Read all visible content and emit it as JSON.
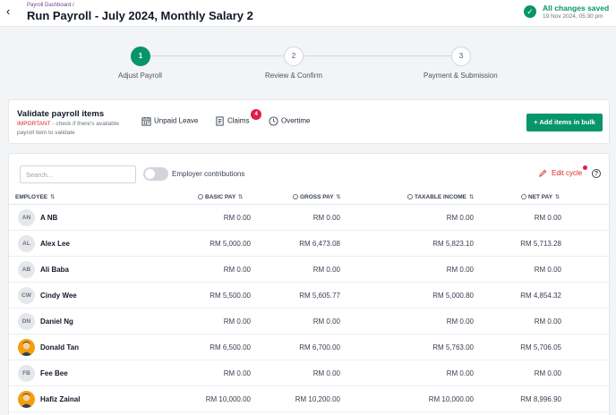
{
  "header": {
    "breadcrumb": "Payroll Dashboard /",
    "title": "Run Payroll - July 2024, Monthly Salary 2",
    "save_status": "All changes saved",
    "save_time": "19 Nov 2024, 05:30 pm",
    "status_color": "#079669"
  },
  "steps": [
    {
      "number": "1",
      "label": "Adjust Payroll",
      "active": true
    },
    {
      "number": "2",
      "label": "Review & Confirm",
      "active": false
    },
    {
      "number": "3",
      "label": "Payment & Submission",
      "active": false
    }
  ],
  "validate": {
    "title": "Validate payroll items",
    "important": "IMPORTANT",
    "subtitle": " - check if there's available payroll item to validate",
    "items": {
      "unpaid_leave": "Unpaid Leave",
      "claims": "Claims",
      "claims_badge": "4",
      "overtime": "Overtime"
    },
    "add_bulk_label": "+ Add items in bulk"
  },
  "table": {
    "search_placeholder": "Search...",
    "toggle_label": "Employer contributions",
    "edit_cycle_label": "Edit cycle",
    "help_glyph": "?",
    "columns": {
      "employee": "EMPLOYEE",
      "basic": "BASIC PAY",
      "gross": "GROSS PAY",
      "taxable": "TAXABLE INCOME",
      "net": "NET PAY",
      "sort_glyph": "⇅"
    },
    "rows": [
      {
        "initials": "AN",
        "name": "A NB",
        "basic": "RM 0.00",
        "gross": "RM 0.00",
        "taxable": "RM 0.00",
        "net": "RM 0.00"
      },
      {
        "initials": "AL",
        "name": "Alex Lee",
        "basic": "RM 5,000.00",
        "gross": "RM 6,473.08",
        "taxable": "RM 5,823.10",
        "net": "RM 5,713.28"
      },
      {
        "initials": "AB",
        "name": "Ali Baba",
        "basic": "RM 0.00",
        "gross": "RM 0.00",
        "taxable": "RM 0.00",
        "net": "RM 0.00"
      },
      {
        "initials": "CW",
        "name": "Cindy Wee",
        "basic": "RM 5,500.00",
        "gross": "RM 5,605.77",
        "taxable": "RM 5,000.80",
        "net": "RM 4,854.32"
      },
      {
        "initials": "DN",
        "name": "Daniel Ng",
        "basic": "RM 0.00",
        "gross": "RM 0.00",
        "taxable": "RM 0.00",
        "net": "RM 0.00"
      },
      {
        "initials": "",
        "name": "Donald Tan",
        "basic": "RM 6,500.00",
        "gross": "RM 6,700.00",
        "taxable": "RM 5,763.00",
        "net": "RM 5,706.05"
      },
      {
        "initials": "FB",
        "name": "Fee Bee",
        "basic": "RM 0.00",
        "gross": "RM 0.00",
        "taxable": "RM 0.00",
        "net": "RM 0.00"
      },
      {
        "initials": "",
        "name": "Hafiz Zainal",
        "basic": "RM 10,000.00",
        "gross": "RM 10,200.00",
        "taxable": "RM 10,000.00",
        "net": "RM 8,996.90"
      }
    ]
  }
}
